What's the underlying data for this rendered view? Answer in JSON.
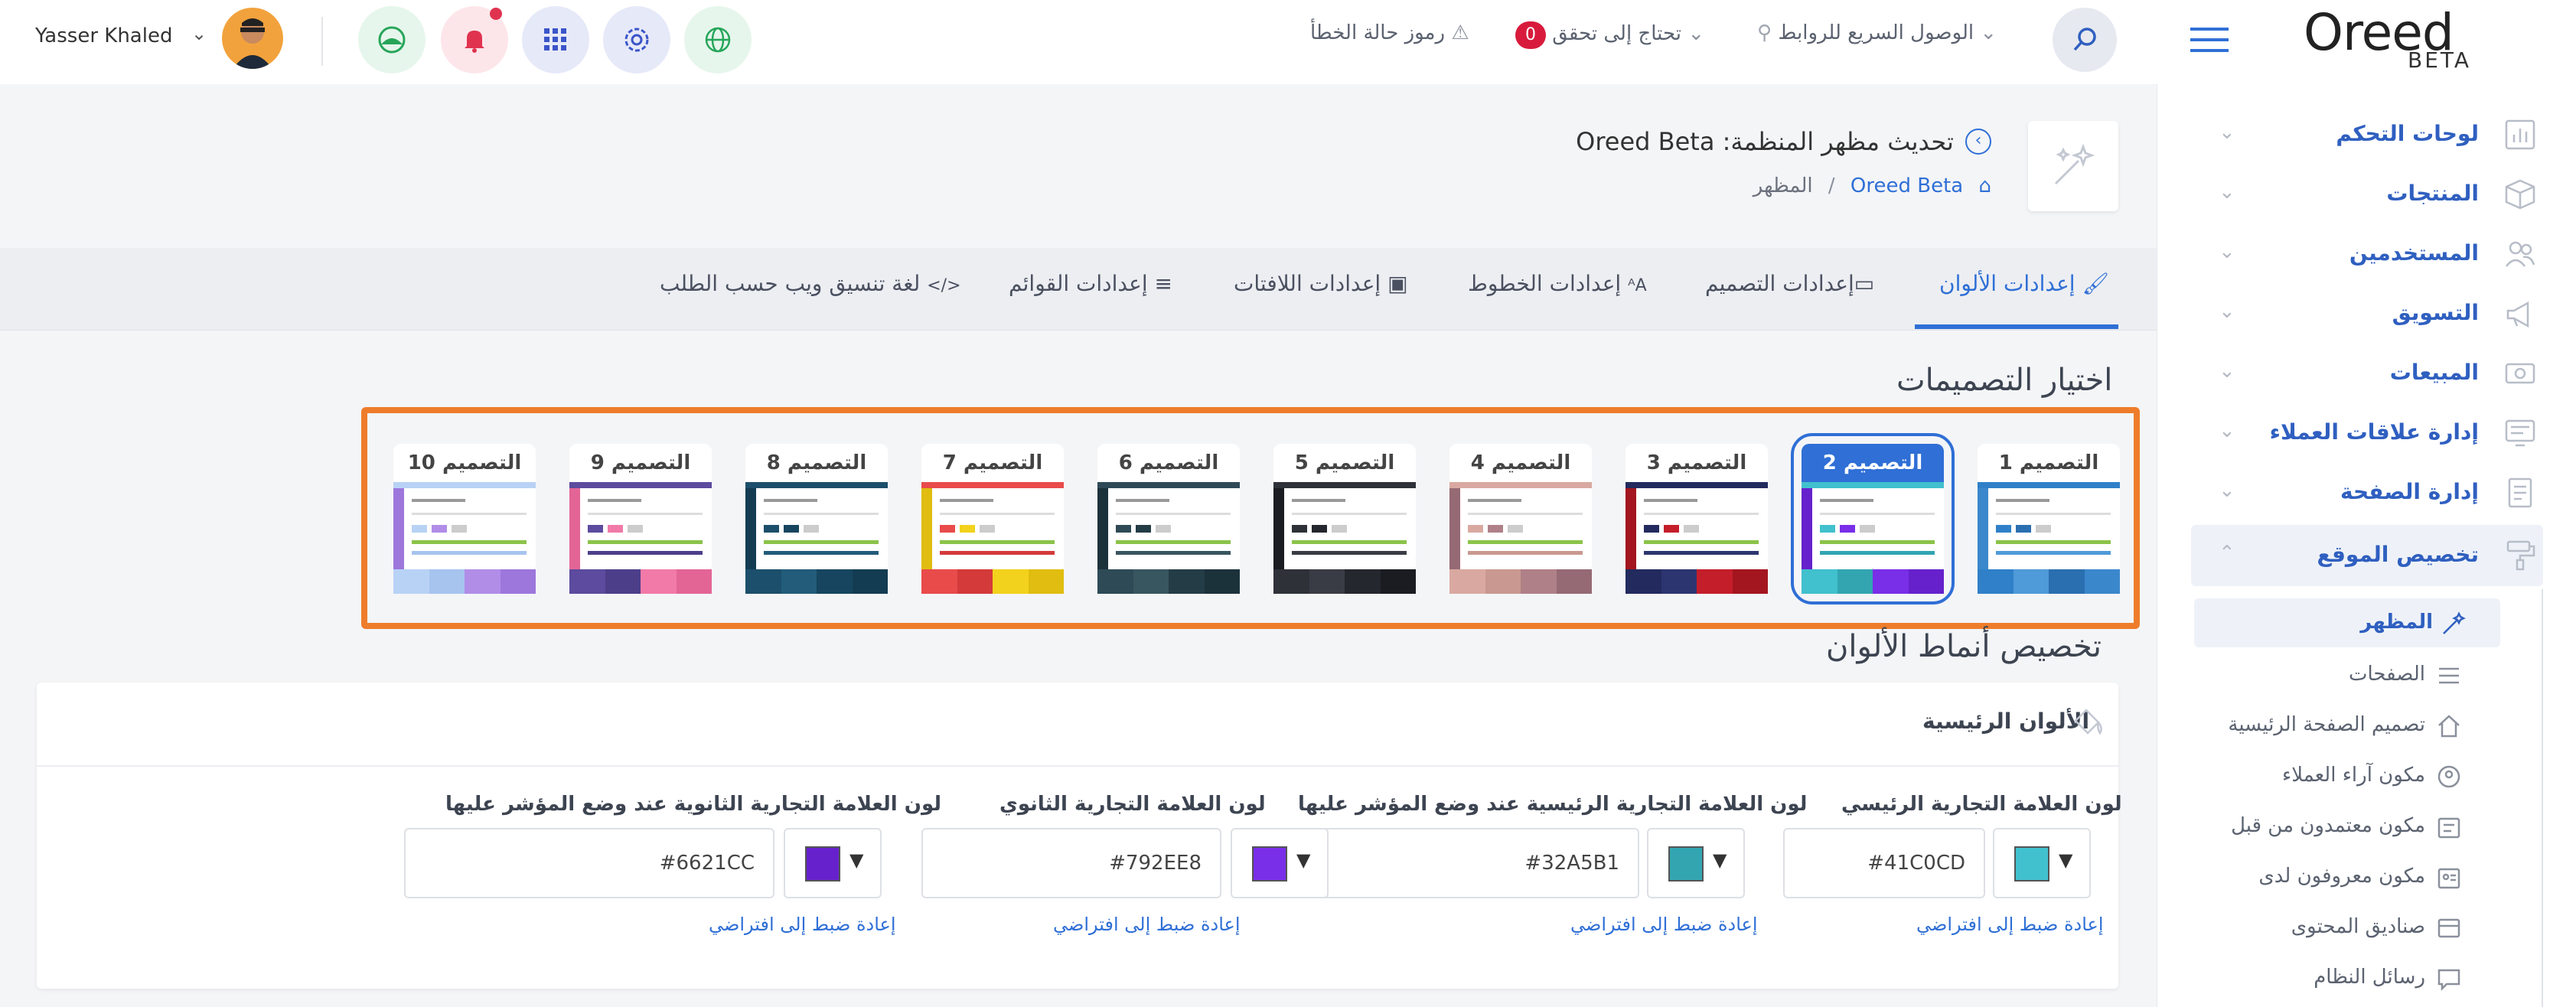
{
  "header": {
    "user_name": "Yasser Khaled",
    "error_codes": "رموز حالة الخطأ",
    "needs_check": "تحتاج إلى تحقق",
    "needs_check_count": "0",
    "quick_links": "الوصول السريع للروابط",
    "logo_text": "Oreed",
    "logo_badge": "BETA",
    "colors": {
      "bell": "#e0334f",
      "accent": "#2f6fd6"
    }
  },
  "sidebar": {
    "items": [
      {
        "label": "لوحات التحكم",
        "icon": "bar-chart-icon"
      },
      {
        "label": "المنتجات",
        "icon": "box-icon"
      },
      {
        "label": "المستخدمين",
        "icon": "users-icon"
      },
      {
        "label": "التسويق",
        "icon": "megaphone-icon"
      },
      {
        "label": "المبيعات",
        "icon": "money-icon"
      },
      {
        "label": "إدارة علاقات العملاء",
        "icon": "crm-icon"
      },
      {
        "label": "إدارة الصفحة",
        "icon": "pages-icon"
      },
      {
        "label": "تخصيص الموقع",
        "icon": "paint-roller-icon"
      }
    ],
    "sub_items": [
      {
        "label": "المظهر",
        "icon": "magic-wand-icon"
      },
      {
        "label": "الصفحات",
        "icon": "list-icon"
      },
      {
        "label": "تصميم الصفحة الرئيسية",
        "icon": "home-icon"
      },
      {
        "label": "مكون آراء العملاء",
        "icon": "testimonial-icon"
      },
      {
        "label": "مكون معتمدون من قبل",
        "icon": "badge-icon"
      },
      {
        "label": "مكون معروفون لدى",
        "icon": "id-card-icon"
      },
      {
        "label": "صناديق المحتوى",
        "icon": "box-content-icon"
      },
      {
        "label": "رسائل النظام",
        "icon": "message-icon"
      }
    ]
  },
  "page": {
    "title": "تحديث مظهر المنظمة: Oreed Beta",
    "breadcrumb_org": "Oreed Beta",
    "breadcrumb_current": "المظهر",
    "breadcrumb_sep": "/"
  },
  "tabs": [
    {
      "label": "إعدادات الألوان"
    },
    {
      "label": "إعدادات التصميم"
    },
    {
      "label": "إعدادات الخطوط"
    },
    {
      "label": "إعدادات اللافتات"
    },
    {
      "label": "إعدادات القوائم"
    },
    {
      "label": "لغة تنسيق ويب حسب الطلب"
    }
  ],
  "templates_title": "اختيار التصميمات",
  "templates": [
    {
      "name": "التصميم 1",
      "colors": [
        "#2f80c8",
        "#4f9ad8",
        "#2a6fb0",
        "#3b87cc"
      ]
    },
    {
      "name": "التصميم 2",
      "colors": [
        "#41C0CD",
        "#32A5B1",
        "#792EE8",
        "#6621CC"
      ]
    },
    {
      "name": "التصميم 3",
      "colors": [
        "#232a5e",
        "#2d3570",
        "#c41e2a",
        "#a3161f"
      ]
    },
    {
      "name": "التصميم 4",
      "colors": [
        "#d9a9a1",
        "#c99890",
        "#b08088",
        "#956a74"
      ]
    },
    {
      "name": "التصميم 5",
      "colors": [
        "#2e3138",
        "#393c44",
        "#24272d",
        "#1a1c21"
      ]
    },
    {
      "name": "التصميم 6",
      "colors": [
        "#2e4a56",
        "#38565f",
        "#243c46",
        "#1c323b"
      ]
    },
    {
      "name": "التصميم 7",
      "colors": [
        "#e94b4b",
        "#d43a3a",
        "#f2d21c",
        "#e0bd10"
      ]
    },
    {
      "name": "التصميم 8",
      "colors": [
        "#1c4f6b",
        "#225c7a",
        "#17455f",
        "#133c53"
      ]
    },
    {
      "name": "التصميم 9",
      "colors": [
        "#5c4b9e",
        "#4d3e8a",
        "#f17aa8",
        "#e36596"
      ]
    },
    {
      "name": "التصميم 10",
      "colors": [
        "#b8d2f5",
        "#a6c4ee",
        "#b18de8",
        "#9d77dc"
      ]
    }
  ],
  "patterns_title": "تخصيص أنماط الألوان",
  "colors_card": {
    "title": "الألوان الرئيسية",
    "reset_label": "إعادة ضبط إلى افتراضي",
    "fields": [
      {
        "label": "لون العلامة التجارية الرئيسي",
        "value": "#41C0CD",
        "color": "#41C0CD"
      },
      {
        "label": "لون العلامة التجارية الرئيسية عند وضع المؤشر عليها",
        "value": "#32A5B1",
        "color": "#32A5B1"
      },
      {
        "label": "لون العلامة التجارية الثانوي",
        "value": "#792EE8",
        "color": "#792EE8"
      },
      {
        "label": "لون العلامة التجارية الثانوية عند وضع المؤشر عليها",
        "value": "#6621CC",
        "color": "#6621CC"
      }
    ]
  }
}
